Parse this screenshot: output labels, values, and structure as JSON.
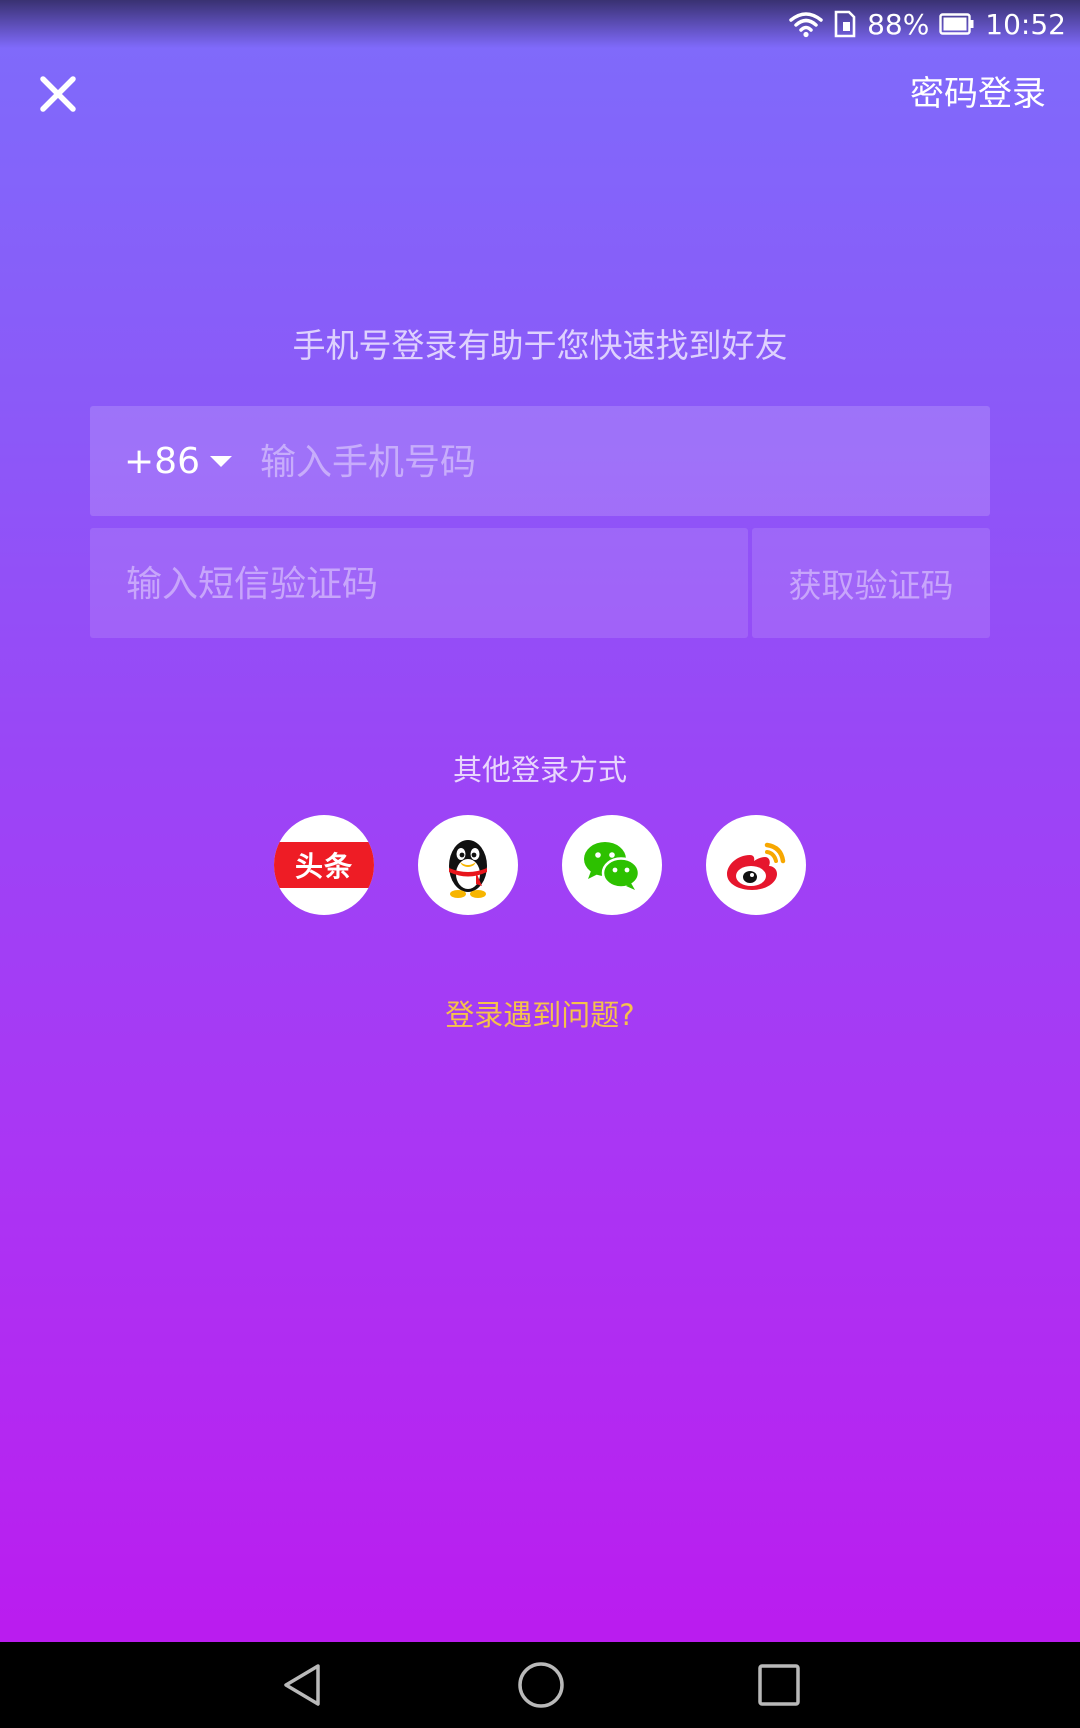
{
  "status_bar": {
    "battery_percent": "88%",
    "time": "10:52",
    "icons": [
      "wifi-icon",
      "sim-icon",
      "battery-icon"
    ]
  },
  "top_bar": {
    "close_icon": "close-icon",
    "password_login_label": "密码登录"
  },
  "headline": "手机号登录有助于您快速找到好友",
  "phone_field": {
    "country_code": "+86",
    "dropdown_icon": "caret-down-icon",
    "value": "",
    "placeholder": "输入手机号码"
  },
  "sms_field": {
    "value": "",
    "placeholder": "输入短信验证码",
    "get_code_label": "获取验证码"
  },
  "other_login": {
    "title": "其他登录方式",
    "options": [
      {
        "name": "toutiao",
        "label": "头条",
        "icon": "toutiao-icon",
        "color": "#ee1c25"
      },
      {
        "name": "qq",
        "icon": "qq-penguin-icon",
        "color": "#000000"
      },
      {
        "name": "wechat",
        "icon": "wechat-icon",
        "color": "#2dc100"
      },
      {
        "name": "weibo",
        "icon": "weibo-icon",
        "color": "#e6162d"
      }
    ]
  },
  "trouble_link": "登录遇到问题?",
  "colors": {
    "gradient_top": "#7e6cfb",
    "gradient_bottom": "#bd16ee",
    "link": "#f6c24a"
  },
  "nav_bar": {
    "icons": [
      "back-icon",
      "home-icon",
      "recents-icon"
    ]
  }
}
